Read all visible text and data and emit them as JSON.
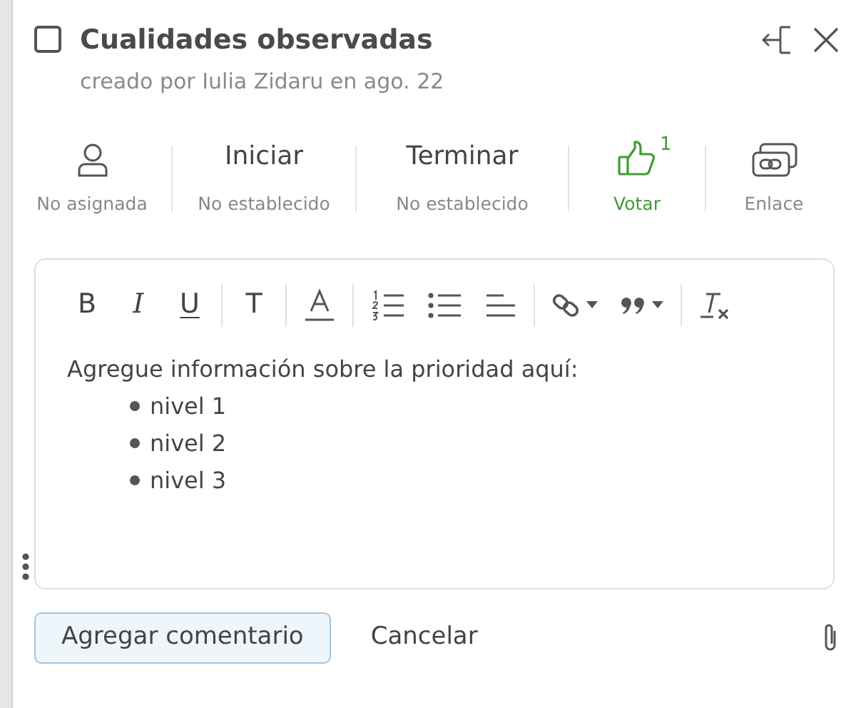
{
  "task": {
    "checked": false,
    "title": "Cualidades observadas",
    "subtitle": "creado por Iulia Zidaru en ago. 22"
  },
  "fields": [
    {
      "kind": "assignee",
      "label": "No asignada"
    },
    {
      "kind": "date",
      "heading": "Iniciar",
      "label": "No establecido"
    },
    {
      "kind": "date",
      "heading": "Terminar",
      "label": "No establecido"
    },
    {
      "kind": "vote",
      "count": "1",
      "label": "Votar",
      "voted": true
    },
    {
      "kind": "link",
      "label": "Enlace"
    }
  ],
  "toolbar": [
    [
      {
        "kind": "letter",
        "text": "B"
      },
      {
        "kind": "italic",
        "text": "I"
      },
      {
        "kind": "underline",
        "text": "U"
      }
    ],
    [
      {
        "kind": "letter",
        "text": "T"
      }
    ],
    [
      {
        "kind": "font-color"
      }
    ],
    [
      {
        "kind": "ordered-list"
      },
      {
        "kind": "bullet-list"
      },
      {
        "kind": "align"
      }
    ],
    [
      {
        "kind": "link",
        "dropdown": true
      },
      {
        "kind": "quote",
        "dropdown": true
      }
    ],
    [
      {
        "kind": "clear-format"
      }
    ]
  ],
  "editor": {
    "paragraph": "Agregue información sobre la prioridad aquí:",
    "items": [
      "nivel 1",
      "nivel 2",
      "nivel 3"
    ]
  },
  "buttons": [
    {
      "label": "Agregar comentario",
      "primary": true
    },
    {
      "label": "Cancelar",
      "primary": false
    }
  ]
}
